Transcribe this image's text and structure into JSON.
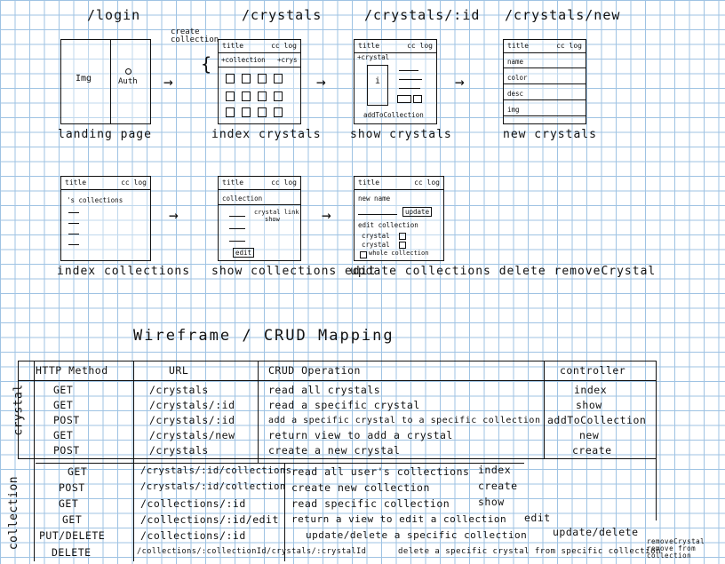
{
  "routes": {
    "login": "/login",
    "crystals": "/crystals",
    "crystal_id": "/crystals/:id",
    "crystals_new": "/crystals/new"
  },
  "annotations": {
    "create_collection": "create collection"
  },
  "wireframes": {
    "landing": {
      "img": "Img",
      "auth": "Auth",
      "caption": "landing page"
    },
    "index_crystals": {
      "title": "title",
      "links": "cc log",
      "collection": "+collection",
      "crys": "+crys",
      "caption": "index crystals"
    },
    "show_crystals": {
      "title": "title",
      "links": "cc log",
      "crystal": "+crystal",
      "info": "i",
      "add": "addToCollection",
      "caption": "show crystals"
    },
    "new_crystals": {
      "title": "title",
      "links": "cc log",
      "fields": [
        "name",
        "color",
        "desc",
        "img"
      ],
      "caption": "new crystals"
    },
    "index_collections": {
      "title": "title",
      "links": "cc log",
      "heading": "'s collections",
      "caption": "index collections"
    },
    "show_collections": {
      "title": "title",
      "links": "cc log",
      "heading": "collection",
      "link_text": "crystal link",
      "show_text": "show",
      "edit": "edit",
      "caption": "show collections edit"
    },
    "update_collections": {
      "title": "title",
      "links": "cc log",
      "new_name": "new name",
      "update": "update",
      "edit_collection": "edit collection",
      "items": [
        "crystal",
        "crystal"
      ],
      "whole": "whole collection",
      "caption": "update collections delete removeCrystal"
    }
  },
  "crud": {
    "title": "Wireframe / CRUD Mapping",
    "headers": [
      "HTTP Method",
      "URL",
      "CRUD Operation",
      "controller"
    ],
    "crystal_label": "crystal",
    "collection_label": "collection",
    "crystal_rows": [
      {
        "method": "GET",
        "url": "/crystals",
        "op": "read all crystals",
        "controller": "index"
      },
      {
        "method": "GET",
        "url": "/crystals/:id",
        "op": "read a specific crystal",
        "controller": "show"
      },
      {
        "method": "POST",
        "url": "/crystals/:id",
        "op": "add a specific crystal to a specific collection",
        "controller": "addToCollection"
      },
      {
        "method": "GET",
        "url": "/crystals/new",
        "op": "return view to add a crystal",
        "controller": "new"
      },
      {
        "method": "POST",
        "url": "/crystals",
        "op": "create a new crystal",
        "controller": "create"
      }
    ],
    "collection_rows": [
      {
        "method": "GET",
        "url": "/crystals/:id/collections",
        "op": "read all user's collections",
        "controller": "index"
      },
      {
        "method": "POST",
        "url": "/crystals/:id/collection",
        "op": "create new collection",
        "controller": "create"
      },
      {
        "method": "GET",
        "url": "/collections/:id",
        "op": "read specific collection",
        "controller": "show"
      },
      {
        "method": "GET",
        "url": "/collections/:id/edit",
        "op": "return a view to edit a collection",
        "controller": "edit"
      },
      {
        "method": "PUT/DELETE",
        "url": "/collections/:id",
        "op": "update/delete a specific collection",
        "controller": "update/delete"
      },
      {
        "method": "DELETE",
        "url": "/collections/:collectionId/crystals/:crystalId",
        "op": "delete a specific crystal from specific collection",
        "controller": "removeCrystal remove from collection"
      }
    ]
  }
}
